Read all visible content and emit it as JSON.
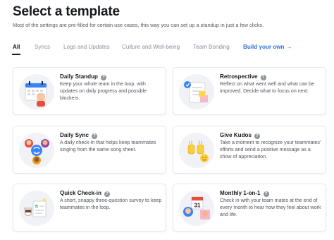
{
  "header": {
    "title": "Select a template",
    "subtitle": "Most of the settings are pre-filled for certain use cases, this way you can set up a standup in just a few clicks."
  },
  "tabs": [
    {
      "label": "All",
      "active": true
    },
    {
      "label": "Syncs"
    },
    {
      "label": "Logs and Updates"
    },
    {
      "label": "Culture and Well-being"
    },
    {
      "label": "Team Bonding"
    },
    {
      "label": "Build your own",
      "arrow": "→"
    }
  ],
  "cards": [
    {
      "title": "Daily Standup",
      "help": "?",
      "description": "Keep your whole team in the loop, with updates on daily progress and possible blockers.",
      "icon": "calendar-team-icon"
    },
    {
      "title": "Retrospective",
      "help": "?",
      "description": "Reflect on what went well and what can be improved. Decide what to focus on next.",
      "icon": "sticky-notes-icon"
    },
    {
      "title": "Daily Sync",
      "help": "?",
      "description": "A daily check-in that helps keep teammates singing from the same song sheet.",
      "icon": "sync-people-icon"
    },
    {
      "title": "Give Kudos",
      "help": "?",
      "description": "Take a moment to recognize your teammates' efforts and send a positive message as a show of appreciation.",
      "icon": "clapping-hands-icon"
    },
    {
      "title": "Quick Check-in",
      "help": "?",
      "description": "A short, snappy three-question survey to keep teammates in the loop.",
      "icon": "coffee-checklist-icon"
    },
    {
      "title": "Monthly 1-on-1",
      "help": "?",
      "description": "Check in with your team mates at the end of every month to hear how they feel about work and life.",
      "icon": "calendar-31-icon",
      "calendar_day": "31"
    }
  ],
  "colors": {
    "accent": "#2f6fde",
    "text": "#17191c",
    "card_border": "#e6e8eb"
  }
}
